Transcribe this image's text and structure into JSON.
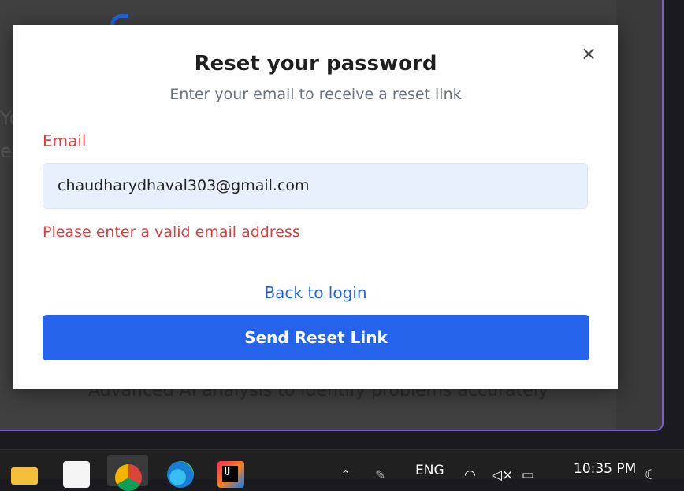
{
  "background": {
    "left_fragment_1": "Yo",
    "left_fragment_2": "e",
    "feature_text": "Advanced AI analysis to identify problems accurately"
  },
  "modal": {
    "title": "Reset your password",
    "subtitle": "Enter your email to receive a reset link",
    "close_icon": "×",
    "email_label": "Email",
    "email_value": "chaudharydhaval303@gmail.com",
    "error_message": "Please enter a valid email address",
    "back_link": "Back to login",
    "submit_label": "Send Reset Link",
    "colors": {
      "primary": "#2563eb",
      "error": "#e23b3b",
      "input_bg": "#e8f0fe"
    }
  },
  "taskbar": {
    "apps": [
      "file-explorer-icon",
      "microsoft-store-icon",
      "chrome-icon",
      "edge-icon",
      "intellij-idea-icon"
    ],
    "language": "ENG",
    "time": "10:35 PM"
  }
}
